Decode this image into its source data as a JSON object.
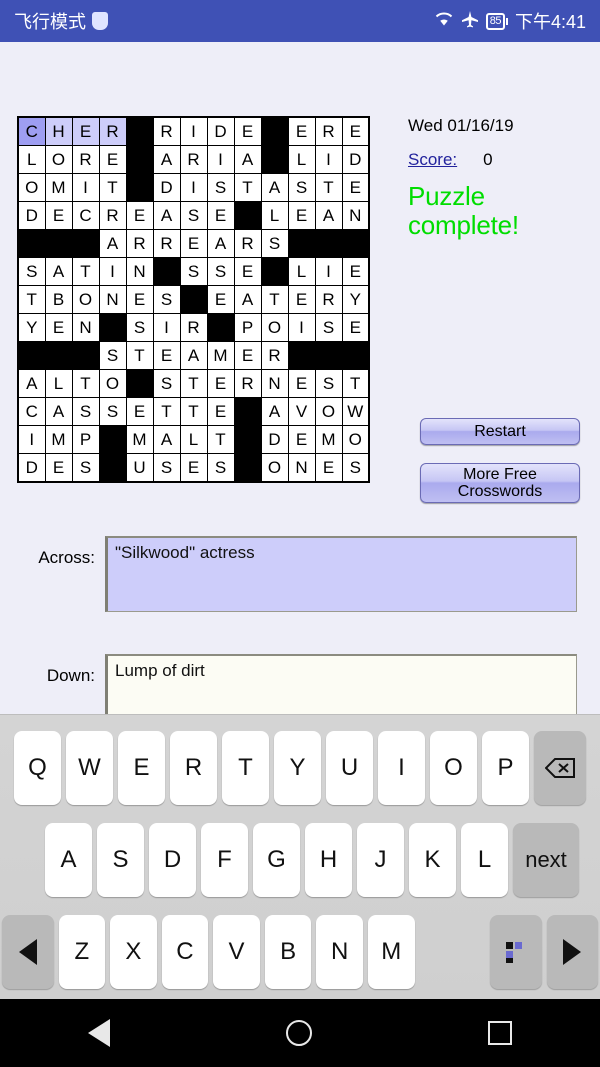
{
  "status_bar": {
    "mode_label": "飞行模式",
    "shield_icon": "shield-icon",
    "wifi_icon": "wifi-icon",
    "airplane_icon": "airplane-icon",
    "battery_level": "85",
    "clock": "下午4:41"
  },
  "info": {
    "date": "Wed 01/16/19",
    "score_label": "Score:",
    "score_value": "0",
    "complete_message": "Puzzle complete!",
    "complete_color": "#00dd00"
  },
  "buttons": {
    "restart": "Restart",
    "more_free": "More Free\nCrosswords",
    "more_free_line1": "More Free",
    "more_free_line2": "Crosswords"
  },
  "clues": {
    "across_label": "Across:",
    "across_value": "\"Silkwood\" actress",
    "down_label": "Down:",
    "down_value": "Lump of dirt"
  },
  "crossword": {
    "rows": 13,
    "cols": 13,
    "cursor": [
      0,
      0
    ],
    "highlight_row": 0,
    "highlight_cols": [
      0,
      1,
      2,
      3
    ],
    "colors": {
      "cursor": "#9e9ef2",
      "highlight": "#cdcdfa",
      "block": "#000000",
      "cell": "#ffffff"
    },
    "grid": [
      [
        "C",
        "H",
        "E",
        "R",
        "#",
        "R",
        "I",
        "D",
        "E",
        "#",
        "E",
        "R",
        "E"
      ],
      [
        "L",
        "O",
        "R",
        "E",
        "#",
        "A",
        "R",
        "I",
        "A",
        "#",
        "L",
        "I",
        "D"
      ],
      [
        "O",
        "M",
        "I",
        "T",
        "#",
        "D",
        "I",
        "S",
        "T",
        "A",
        "S",
        "T",
        "E"
      ],
      [
        "D",
        "E",
        "C",
        "R",
        "E",
        "A",
        "S",
        "E",
        "#",
        "L",
        "E",
        "A",
        "N"
      ],
      [
        "#",
        "#",
        "#",
        "A",
        "R",
        "R",
        "E",
        "A",
        "R",
        "S",
        "#",
        "#",
        "#"
      ],
      [
        "S",
        "A",
        "T",
        "I",
        "N",
        "#",
        "S",
        "S",
        "E",
        "#",
        "L",
        "I",
        "E"
      ],
      [
        "T",
        "B",
        "O",
        "N",
        "E",
        "S",
        "#",
        "E",
        "A",
        "T",
        "E",
        "R",
        "Y"
      ],
      [
        "Y",
        "E",
        "N",
        "#",
        "S",
        "I",
        "R",
        "#",
        "P",
        "O",
        "I",
        "S",
        "E"
      ],
      [
        "#",
        "#",
        "#",
        "S",
        "T",
        "E",
        "A",
        "M",
        "E",
        "R",
        "#",
        "#",
        "#"
      ],
      [
        "A",
        "L",
        "T",
        "O",
        "#",
        "S",
        "T",
        "E",
        "R",
        "N",
        "E",
        "S",
        "T"
      ],
      [
        "C",
        "A",
        "S",
        "S",
        "E",
        "T",
        "T",
        "E",
        "#",
        "A",
        "V",
        "O",
        "W"
      ],
      [
        "I",
        "M",
        "P",
        "#",
        "M",
        "A",
        "L",
        "T",
        "#",
        "D",
        "E",
        "M",
        "O"
      ],
      [
        "D",
        "E",
        "S",
        "#",
        "U",
        "S",
        "E",
        "S",
        "#",
        "O",
        "N",
        "E",
        "S"
      ]
    ]
  },
  "keyboard": {
    "row1": [
      "Q",
      "W",
      "E",
      "R",
      "T",
      "Y",
      "U",
      "I",
      "O",
      "P"
    ],
    "row2": [
      "A",
      "S",
      "D",
      "F",
      "G",
      "H",
      "J",
      "K",
      "L"
    ],
    "row3": [
      "Z",
      "X",
      "C",
      "V",
      "B",
      "N",
      "M"
    ],
    "backspace_icon": "backspace-icon",
    "next_label": "next",
    "left_arrow_icon": "arrow-left-icon",
    "right_arrow_icon": "arrow-right-icon",
    "keyboard_switch_icon": "keyboard-layout-icon"
  },
  "navbar": {
    "back_icon": "back-triangle-icon",
    "home_icon": "home-circle-icon",
    "recents_icon": "recents-square-icon"
  }
}
